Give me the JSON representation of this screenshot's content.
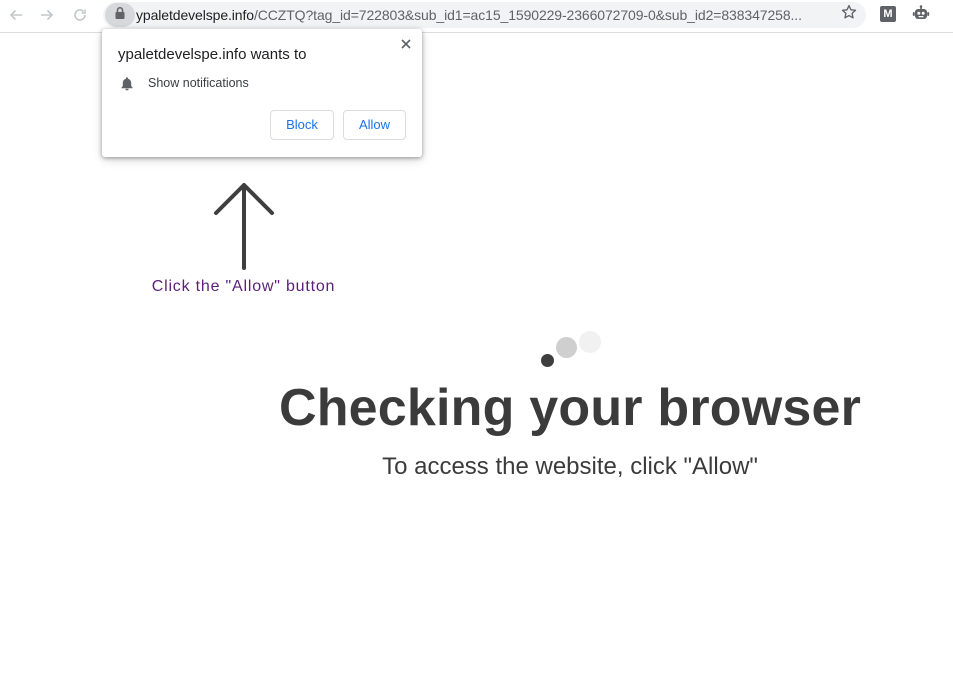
{
  "browser": {
    "url_host": "ypaletdevelspe.info",
    "url_path": "/CCZTQ?tag_id=722803&sub_id1=ac15_1590229-2366072709-0&sub_id2=838347258...",
    "back_icon": "arrow-left-icon",
    "forward_icon": "arrow-right-icon",
    "reload_icon": "reload-icon",
    "lock_icon": "lock-icon",
    "bookmark_icon": "star-icon",
    "extensions": [
      {
        "label": "M",
        "icon": "m-extension-icon"
      },
      {
        "label": "",
        "icon": "robot-extension-icon"
      }
    ]
  },
  "permission_popup": {
    "title": "ypaletdevelspe.info wants to",
    "permission_label": "Show notifications",
    "permission_icon": "bell-icon",
    "block_label": "Block",
    "allow_label": "Allow",
    "close_icon": "close-icon"
  },
  "page": {
    "hint": "Click the \"Allow\" button",
    "title": "Checking your browser",
    "subtitle": "To access the website, click \"Allow\"",
    "hint_color": "#5b1f7a",
    "text_color": "#3b3b3b",
    "accent_color": "#1a73e8"
  }
}
